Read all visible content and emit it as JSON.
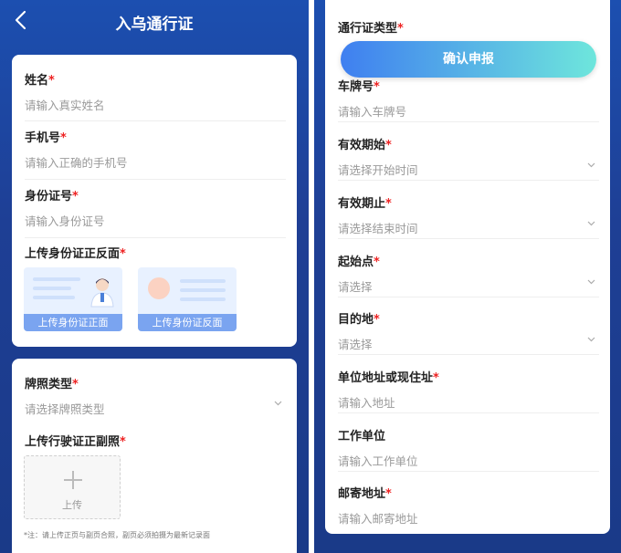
{
  "header": {
    "title": "入乌通行证"
  },
  "personal": {
    "name_label": "姓名",
    "name_placeholder": "请输入真实姓名",
    "phone_label": "手机号",
    "phone_placeholder": "请输入正确的手机号",
    "id_label": "身份证号",
    "id_placeholder": "请输入身份证号",
    "upload_label": "上传身份证正反面",
    "upload_front": "上传身份证正面",
    "upload_back": "上传身份证反面"
  },
  "vehicle": {
    "plate_type_label": "牌照类型",
    "plate_type_placeholder": "请选择牌照类型",
    "license_label": "上传行驶证正副照",
    "upload_caption": "上传",
    "note": "*注：请上传正页与副页合照，副页必须拍摄为最新记录面"
  },
  "right": {
    "pass_type_label": "通行证类型",
    "confirm_label": "确认申报",
    "plate_label": "车牌号",
    "plate_placeholder": "请输入车牌号",
    "start_label": "有效期始",
    "start_placeholder": "请选择开始时间",
    "end_label": "有效期止",
    "end_placeholder": "请选择结束时间",
    "origin_label": "起始点",
    "origin_placeholder": "请选择",
    "dest_label": "目的地",
    "dest_placeholder": "请选择",
    "address_label": "单位地址或现住址",
    "address_placeholder": "请输入地址",
    "work_label": "工作单位",
    "work_placeholder": "请输入工作单位",
    "mail_label": "邮寄地址",
    "mail_placeholder": "请输入邮寄地址"
  },
  "required_mark": "*",
  "icons": [
    "back-arrow-icon",
    "chevron-down-icon",
    "plus-icon",
    "id-avatar-icon"
  ],
  "colors": {
    "brand_blue": "#1e3f95",
    "required": "#e22222",
    "button_start": "#3f7ff0",
    "button_end": "#6ee6dc"
  }
}
